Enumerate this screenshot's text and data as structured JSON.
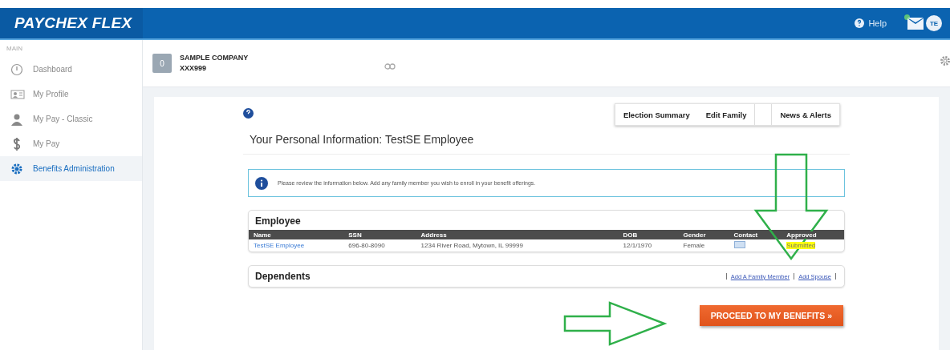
{
  "header": {
    "logo": "PAYCHEX FLEX",
    "help": "Help",
    "avatar": "TE"
  },
  "sidebar": {
    "section": "MAIN",
    "items": [
      {
        "label": "Dashboard",
        "selected": false
      },
      {
        "label": "My Profile",
        "selected": false
      },
      {
        "label": "My Pay - Classic",
        "selected": false
      },
      {
        "label": "My Pay",
        "selected": false
      },
      {
        "label": "Benefits Administration",
        "selected": true
      }
    ]
  },
  "company": {
    "badge": "0",
    "name": "SAMPLE COMPANY",
    "code": "XXX999"
  },
  "tabs": [
    {
      "label": "Election Summary"
    },
    {
      "label": "Edit Family"
    },
    {
      "label": "News & Alerts"
    }
  ],
  "title": "Your Personal Information: TestSE Employee",
  "info": "Please review the information below. Add any family member you wish to enroll in your benefit offerings.",
  "employee": {
    "title": "Employee",
    "columns": [
      "Name",
      "SSN",
      "Address",
      "DOB",
      "Gender",
      "Contact",
      "Approved"
    ],
    "rows": [
      {
        "name": "TestSE Employee",
        "ssn": "696-80-8090",
        "address": "1234 River Road, Mytown, IL 99999",
        "dob": "12/1/1970",
        "gender": "Female",
        "status": "Submitted"
      }
    ]
  },
  "dependents": {
    "title": "Dependents",
    "links": [
      "Add A Family Member",
      "Add Spouse"
    ]
  },
  "proceed": "PROCEED TO MY BENEFITS »"
}
